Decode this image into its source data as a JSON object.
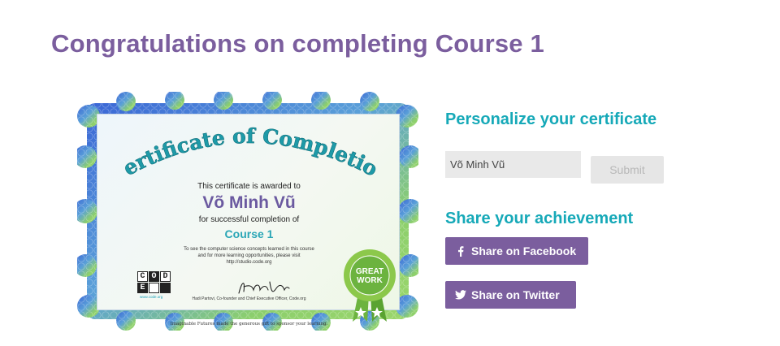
{
  "page": {
    "title": "Congratulations on completing Course 1"
  },
  "certificate": {
    "heading": "Certificate of Completion",
    "awarded_text": "This certificate is awarded to",
    "recipient_name": "Võ Minh Vũ",
    "completion_text": "for successful completion of",
    "course_name": "Course 1",
    "info_line_1": "To see the computer science concepts learned in this course",
    "info_line_2": "and for more learning opportunities, please visit",
    "info_line_3": "http://studio.code.org",
    "logo_letters": [
      "C",
      "O",
      "D",
      "E"
    ],
    "logo_url": "www.code.org",
    "signature": "Hadi Partovi",
    "signer_caption": "Hadi Partovi, Co-founder and Chief Executive Officer, Code.org",
    "sponsor_text": "Imaginable Futures made the generous gift to sponsor your learning.",
    "badge_top": "GREAT",
    "badge_bottom": "WORK",
    "badge_ring_text": "ANYONE CAN LEARN COMPUTER SCIENCE • CODE.ORG"
  },
  "personalize": {
    "heading": "Personalize your certificate",
    "name_value": "Võ Minh Vũ",
    "submit_label": "Submit"
  },
  "share": {
    "heading": "Share your achievement",
    "facebook_label": "Share on Facebook",
    "twitter_label": "Share on Twitter",
    "facebook_icon": "facebook-icon",
    "twitter_icon": "twitter-icon"
  },
  "colors": {
    "title_purple": "#7b5e9e",
    "heading_teal": "#16a9b8",
    "button_purple": "#7b5e9e",
    "input_gray": "#e9e9e9",
    "submit_disabled": "#e6e6e6",
    "badge_green": "#7cc242"
  }
}
